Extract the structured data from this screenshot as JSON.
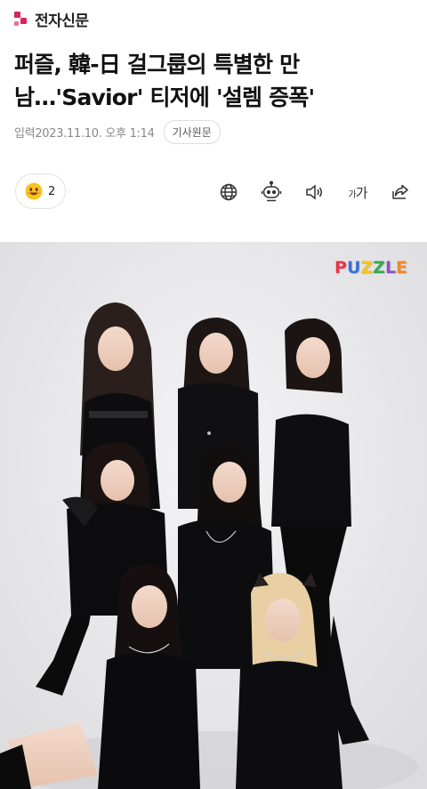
{
  "header": {
    "logo_text": "전자신문",
    "logo_color": "#d6245c"
  },
  "article": {
    "headline": "퍼즐, 韓-日 걸그룹의 특별한 만남…'Savior' 티저에 '설렘 증폭'",
    "date": "입력2023.11.10. 오후 1:14",
    "source_button": "기사원문"
  },
  "reaction": {
    "emoji": "smiling-face",
    "count": "2"
  },
  "tools": [
    {
      "name": "globe-icon"
    },
    {
      "name": "robot-summary-icon"
    },
    {
      "name": "speaker-icon"
    },
    {
      "name": "font-size-icon",
      "label_small": "가",
      "label_big": "가"
    },
    {
      "name": "share-icon"
    }
  ],
  "photo": {
    "subject": "group-photo",
    "logo_letters": [
      "P",
      "U",
      "Z",
      "Z",
      "L",
      "E"
    ],
    "logo_colors": [
      "#e8344a",
      "#3b6fd6",
      "#f2c31b",
      "#3aa64e",
      "#8f4fc8",
      "#f08a2a"
    ]
  }
}
